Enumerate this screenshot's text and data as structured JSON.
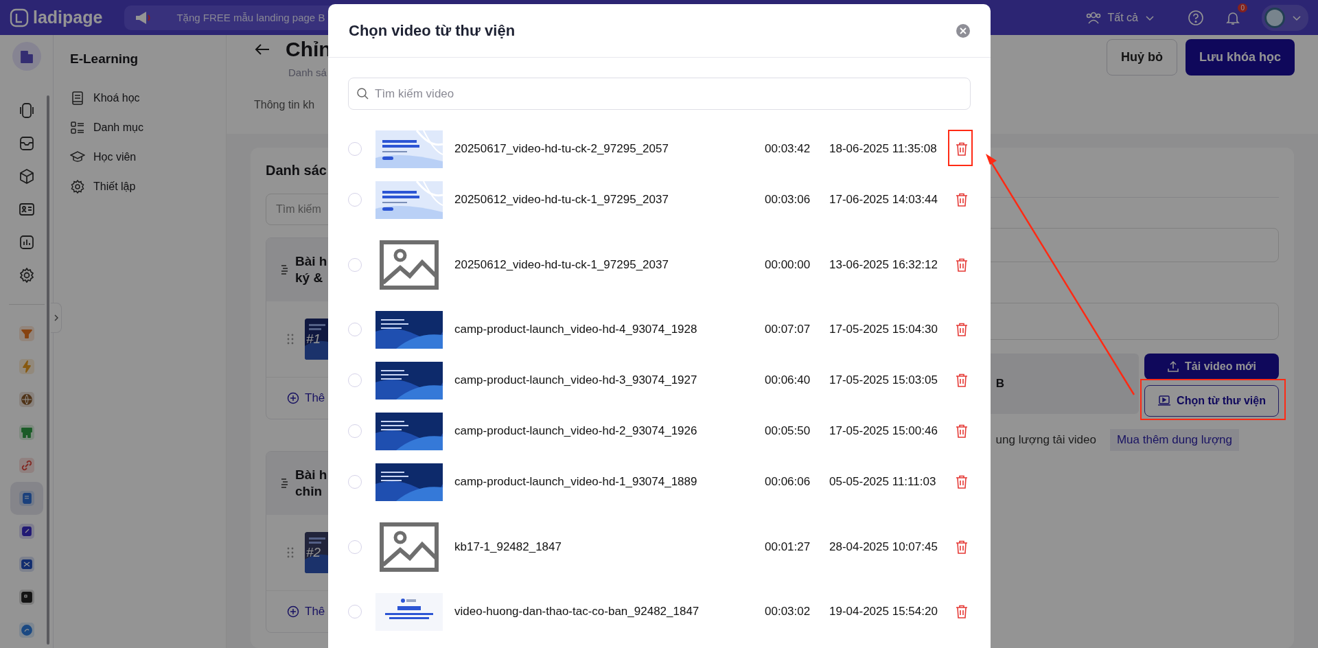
{
  "topbar": {
    "logo": "ladipage",
    "promo": "Tặng FREE mẫu landing page B",
    "filter": "Tất cả",
    "notifications": "0"
  },
  "rail": [
    {
      "selected": false
    },
    {
      "selected": false
    },
    {
      "selected": false
    },
    {
      "selected": false
    },
    {
      "selected": false
    },
    {
      "selected": false
    },
    {
      "selected": false
    },
    {
      "selected": false
    },
    {
      "selected": false
    },
    {
      "selected": false
    },
    {
      "selected": false
    },
    {
      "selected": false
    },
    {
      "selected": true
    },
    {
      "selected": false
    },
    {
      "selected": false
    },
    {
      "selected": false
    },
    {
      "selected": false
    }
  ],
  "subnav": {
    "title": "E-Learning",
    "items": [
      "Khoá học",
      "Danh mục",
      "Học viên",
      "Thiết lập"
    ]
  },
  "header": {
    "title": "Chỉn",
    "subtitle": "Danh sá",
    "tab": "Thông tin kh",
    "buttons": [
      {
        "label": "Huỷ bỏ",
        "kind": "secondary"
      },
      {
        "label": "Lưu khóa học",
        "kind": "primary"
      }
    ]
  },
  "outline": {
    "heading": "Danh sác",
    "search_placeholder": "Tìm kiếm",
    "sections": [
      {
        "title_lines": [
          "Bài h",
          "ký &"
        ],
        "lesson_label": "#1",
        "add": "Thê"
      },
      {
        "title_lines": [
          "Bài h",
          "chỉn"
        ],
        "lesson_label": "#2",
        "add": "Thê"
      }
    ]
  },
  "form": {
    "size_fragment": "B",
    "upload": "Tải video mới",
    "library": "Chọn từ thư viện",
    "storage_note": "ung lượng tải video",
    "buy": "Mua thêm dung lượng"
  },
  "modal": {
    "title": "Chọn video từ thư viện",
    "search_placeholder": "Tìm kiếm video",
    "videos": [
      {
        "name": "20250617_video-hd-tu-ck-2_97295_2057",
        "duration": "00:03:42",
        "date": "18-06-2025 11:35:08",
        "kind": "light",
        "selected": false,
        "highlighted": true
      },
      {
        "name": "20250612_video-hd-tu-ck-1_97295_2037",
        "duration": "00:03:06",
        "date": "17-06-2025 14:03:44",
        "kind": "light",
        "selected": false,
        "highlighted": false
      },
      {
        "name": "20250612_video-hd-tu-ck-1_97295_2037",
        "duration": "00:00:00",
        "date": "13-06-2025 16:32:12",
        "kind": "placeholder",
        "selected": false,
        "highlighted": false
      },
      {
        "name": "camp-product-launch_video-hd-4_93074_1928",
        "duration": "00:07:07",
        "date": "17-05-2025 15:04:30",
        "kind": "dark",
        "selected": false,
        "highlighted": false
      },
      {
        "name": "camp-product-launch_video-hd-3_93074_1927",
        "duration": "00:06:40",
        "date": "17-05-2025 15:03:05",
        "kind": "dark",
        "selected": false,
        "highlighted": false
      },
      {
        "name": "camp-product-launch_video-hd-2_93074_1926",
        "duration": "00:05:50",
        "date": "17-05-2025 15:00:46",
        "kind": "dark",
        "selected": false,
        "highlighted": false
      },
      {
        "name": "camp-product-launch_video-hd-1_93074_1889",
        "duration": "00:06:06",
        "date": "05-05-2025 11:11:03",
        "kind": "dark",
        "selected": false,
        "highlighted": false
      },
      {
        "name": "kb17-1_92482_1847",
        "duration": "00:01:27",
        "date": "28-04-2025 10:07:45",
        "kind": "placeholder",
        "selected": false,
        "highlighted": false
      },
      {
        "name": "video-huong-dan-thao-tac-co-ban_92482_1847",
        "duration": "00:03:02",
        "date": "19-04-2025 15:54:20",
        "kind": "white",
        "selected": false,
        "highlighted": false
      }
    ]
  }
}
